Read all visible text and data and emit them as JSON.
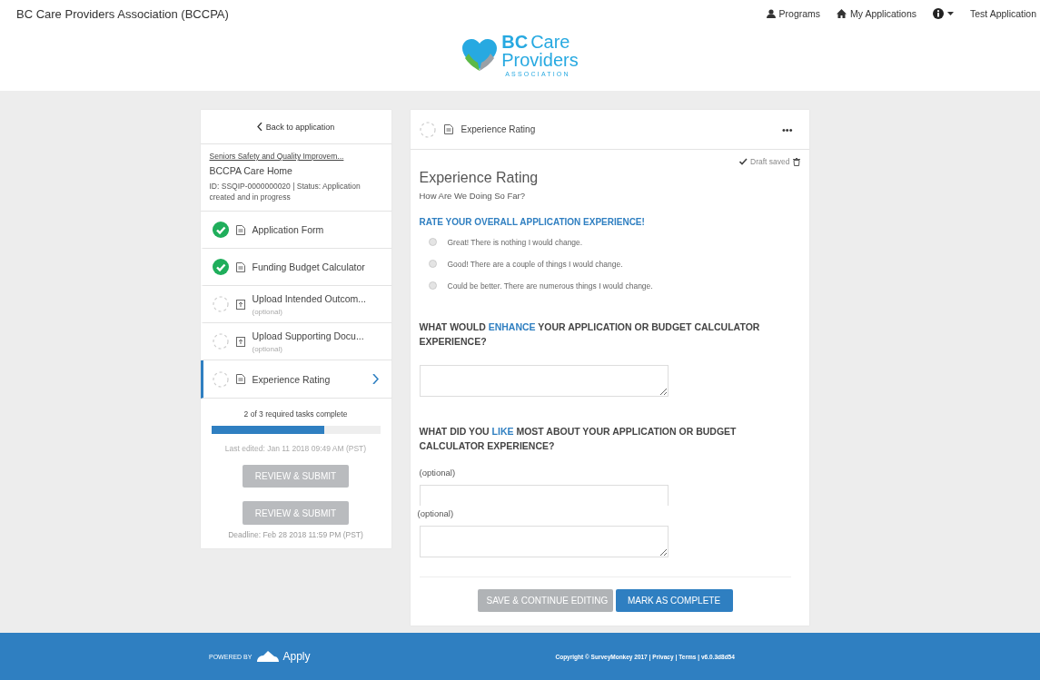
{
  "top_bar": {
    "brand": "BC Care Providers Association (BCCPA)",
    "nav": [
      {
        "kind": "programs",
        "label": "Programs"
      },
      {
        "kind": "home",
        "label": "My Applications"
      },
      {
        "kind": "info"
      },
      {
        "kind": "text",
        "label": "Test Application"
      }
    ]
  },
  "logo": {
    "short": "BC",
    "word1": "Care",
    "word2": "Providers",
    "tagline": "ASSOCIATION"
  },
  "sidebar": {
    "back_link": "Back to application",
    "application": {
      "title_link": "Seniors Safety and Quality Improvem...",
      "organization": "BCCPA Care Home",
      "meta": "ID: SSQIP-0000000020 | Status: Application created and in progress"
    },
    "tasks": [
      {
        "kind": "form",
        "label": "Application Form",
        "done": true,
        "selected": false
      },
      {
        "kind": "form",
        "label": "Funding Budget Calculator",
        "done": true,
        "selected": false
      },
      {
        "kind": "upload",
        "label": "Upload Intended Outcom...",
        "note": "(optional)",
        "done": false,
        "selected": false
      },
      {
        "kind": "upload",
        "label": "Upload Supporting Docu...",
        "note": "(optional)",
        "done": false,
        "selected": false
      },
      {
        "kind": "form",
        "label": "Experience Rating",
        "done": false,
        "selected": true
      }
    ],
    "progress": {
      "text": "2 of 3 required tasks complete",
      "level": 0.67
    },
    "last_edited": "Last edited: Jan 11 2018 09:49 AM (PST)",
    "review_buttons": [
      {
        "label": "REVIEW & SUBMIT",
        "disabled": true
      },
      {
        "label": "REVIEW & SUBMIT",
        "disabled": true
      }
    ],
    "deadline": "Deadline: Feb 28 2018 11:59 PM (PST)"
  },
  "main": {
    "header": {
      "title": "Experience Rating",
      "done": false,
      "menu": "•••"
    },
    "draft_status": "Draft saved",
    "title": "Experience Rating",
    "subtitle": "How Are We Doing So Far?",
    "rating": {
      "heading": "RATE YOUR OVERALL APPLICATION EXPERIENCE!",
      "options": [
        {
          "label": "Great! There is nothing I would change.",
          "selected": false
        },
        {
          "label": "Good! There are a couple of things I would change.",
          "selected": false
        },
        {
          "label": "Could be better. There are numerous things I would change.",
          "selected": false
        }
      ]
    },
    "question_enhance": {
      "heading": "WHAT WOULD **ENHANCE** YOUR APPLICATION OR BUDGET CALCULATOR EXPERIENCE?"
    },
    "question_like": {
      "heading": "WHAT DID YOU **LIKE** MOST ABOUT YOUR APPLICATION OR BUDGET CALCULATOR EXPERIENCE?",
      "note": "(optional)"
    },
    "repeated_note": "(optional)",
    "buttons": [
      {
        "kind": "secondary",
        "label": "SAVE & CONTINUE EDITING",
        "disabled": true
      },
      {
        "kind": "primary",
        "label": "MARK AS COMPLETE",
        "disabled": false
      }
    ]
  },
  "footer": {
    "powered_by": "POWERED BY",
    "brand": "Apply",
    "copyright": "Copyright © SurveyMonkey 2017 |",
    "links": [
      "Privacy",
      "Terms"
    ],
    "separator": "|",
    "version": "| v6.0.3d8d54"
  }
}
